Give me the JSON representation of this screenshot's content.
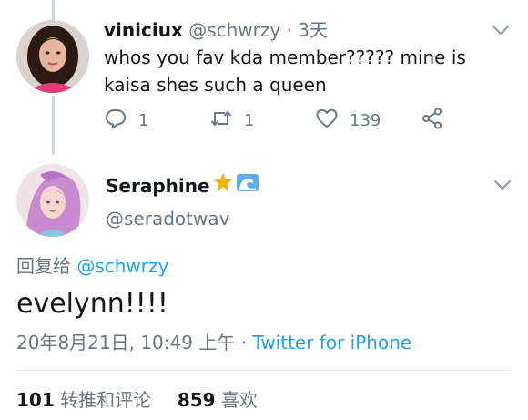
{
  "parent_tweet": {
    "name": "viniciux",
    "handle": "@schwrzy",
    "separator": "·",
    "time": "3天",
    "text": "whos you fav kda member????? mine is kaisa shes such a queen",
    "actions": {
      "reply_count": "1",
      "retweet_count": "1",
      "like_count": "139"
    }
  },
  "reply_tweet": {
    "name": "Seraphine",
    "name_emojis": [
      "star",
      "wave"
    ],
    "handle": "@seradotwav",
    "replying_prefix": "回复给",
    "replying_to": "@schwrzy",
    "text": "evelynn!!!!",
    "timestamp": "20年8月21日, 10:49 上午",
    "meta_separator": "·",
    "source": "Twitter for iPhone",
    "stats": {
      "retweets_count": "101",
      "retweets_label": "转推和评论",
      "likes_count": "859",
      "likes_label": "喜欢"
    }
  },
  "colors": {
    "text": "#14171a",
    "secondary": "#657786",
    "link": "#1da1f2",
    "divider": "#e1e8ed",
    "thread_line": "#ccd6dd"
  },
  "icons": [
    "reply-icon",
    "retweet-icon",
    "like-icon",
    "share-icon",
    "chevron-down-icon",
    "star-icon",
    "wave-icon"
  ]
}
